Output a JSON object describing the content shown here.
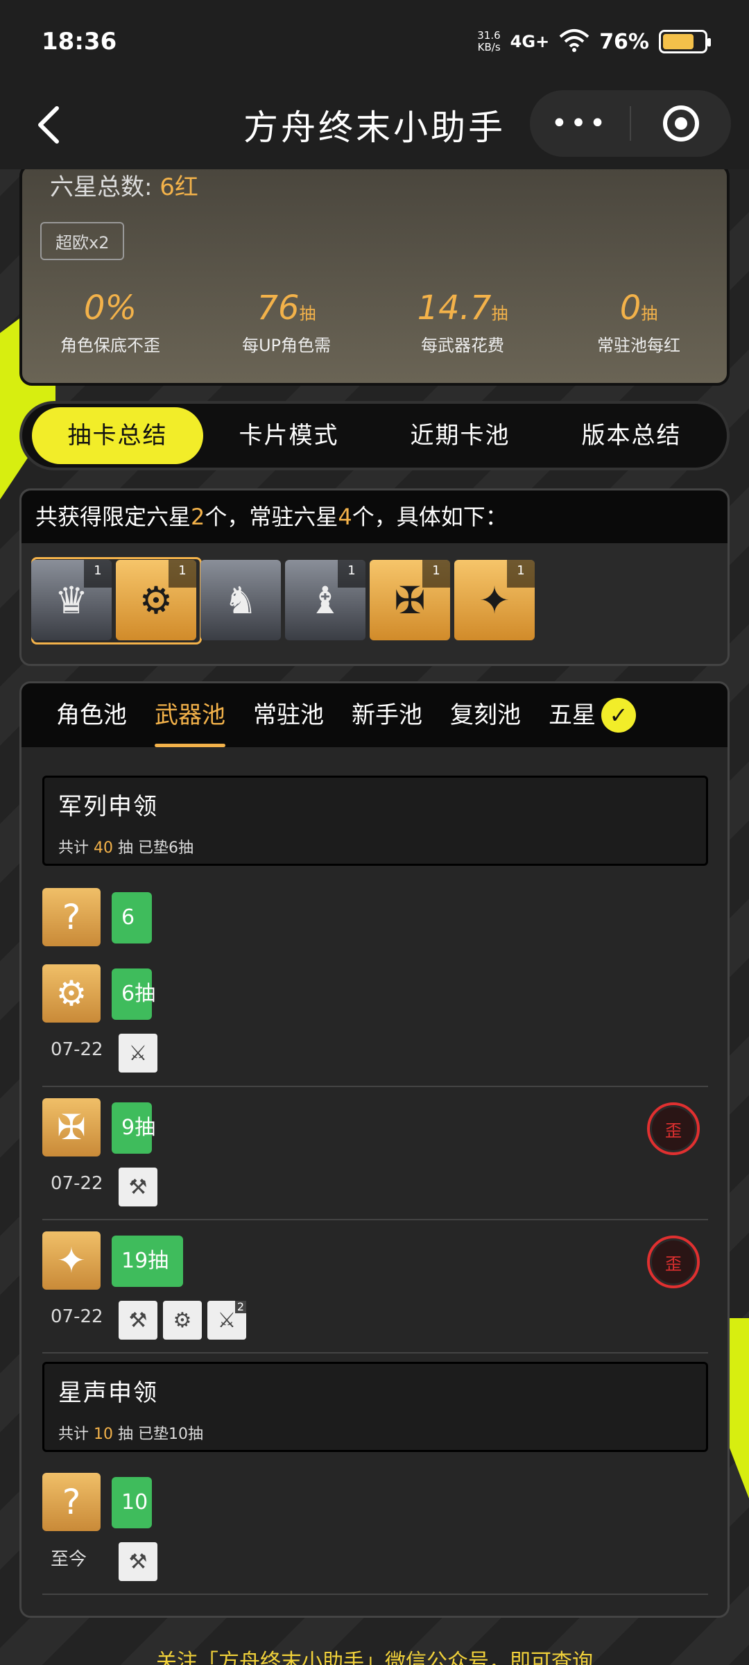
{
  "status": {
    "time": "18:36",
    "net_speed_top": "31.6",
    "net_speed_unit": "KB/s",
    "signal": "4G+",
    "battery_pct": "76%"
  },
  "nav": {
    "back_icon": "chevron-left-icon",
    "title": "方舟终末小助手",
    "more_label": "•••"
  },
  "summary": {
    "six_total_label": "六星总数:",
    "six_total_value": "6红",
    "badge": "超欧x2",
    "stats": [
      {
        "num": "0%",
        "unit": "",
        "label": "角色保底不歪"
      },
      {
        "num": "76",
        "unit": "抽",
        "label": "每UP角色需"
      },
      {
        "num": "14.7",
        "unit": "抽",
        "label": "每武器花费"
      },
      {
        "num": "0",
        "unit": "抽",
        "label": "常驻池每红"
      }
    ]
  },
  "main_tabs": [
    {
      "label": "抽卡总结",
      "active": true
    },
    {
      "label": "卡片模式",
      "active": false
    },
    {
      "label": "近期卡池",
      "active": false
    },
    {
      "label": "版本总结",
      "active": false
    }
  ],
  "acquired": {
    "pre": "共获得限定六星",
    "limited": "2",
    "mid": "个，常驻六星",
    "standard": "4",
    "post": "个，具体如下：",
    "items": [
      {
        "kind": "char",
        "count": "1"
      },
      {
        "kind": "weapon",
        "count": "1"
      },
      {
        "kind": "char",
        "count": ""
      },
      {
        "kind": "char",
        "count": "1"
      },
      {
        "kind": "weapon",
        "count": "1"
      },
      {
        "kind": "weapon",
        "count": "1"
      }
    ]
  },
  "pool_tabs": [
    {
      "label": "角色池",
      "active": false
    },
    {
      "label": "武器池",
      "active": true
    },
    {
      "label": "常驻池",
      "active": false
    },
    {
      "label": "新手池",
      "active": false
    },
    {
      "label": "复刻池",
      "active": false
    },
    {
      "label": "五星",
      "active": false
    }
  ],
  "banners": [
    {
      "name": "军列申领",
      "info_pre": "共计",
      "info_num": "40",
      "info_post": "抽  已垫6抽"
    },
    {
      "name": "星声申领",
      "info_pre": "共计",
      "info_num": "10",
      "info_post": "抽  已垫10抽"
    }
  ],
  "pulls": [
    {
      "icon": "?",
      "bar": "6",
      "bar_fraction": 0.06,
      "date": "",
      "wai": "",
      "minis": []
    },
    {
      "icon": "weapon",
      "bar": "6抽",
      "bar_fraction": 0.06,
      "date": "07-22",
      "wai": "",
      "minis": [
        "sword"
      ]
    },
    {
      "icon": "weapon",
      "bar": "9抽",
      "bar_fraction": 0.09,
      "date": "07-22",
      "wai": "歪",
      "minis": [
        "gun"
      ]
    },
    {
      "icon": "weapon",
      "bar": "19抽",
      "bar_fraction": 0.19,
      "date": "07-22",
      "wai": "歪",
      "minis": [
        "gun",
        "gear",
        "sword"
      ]
    },
    {
      "icon": "?",
      "bar": "10",
      "bar_fraction": 0.1,
      "date": "至今",
      "wai": "",
      "minis": [
        "gun"
      ]
    }
  ],
  "mini_badge": "2",
  "footer": "关注「方舟终末小助手」微信公众号，即可查询",
  "colors": {
    "accent_yellow": "#f2ed29",
    "gold": "#f3b24a",
    "green": "#3fbc5c",
    "red": "#e03030"
  }
}
